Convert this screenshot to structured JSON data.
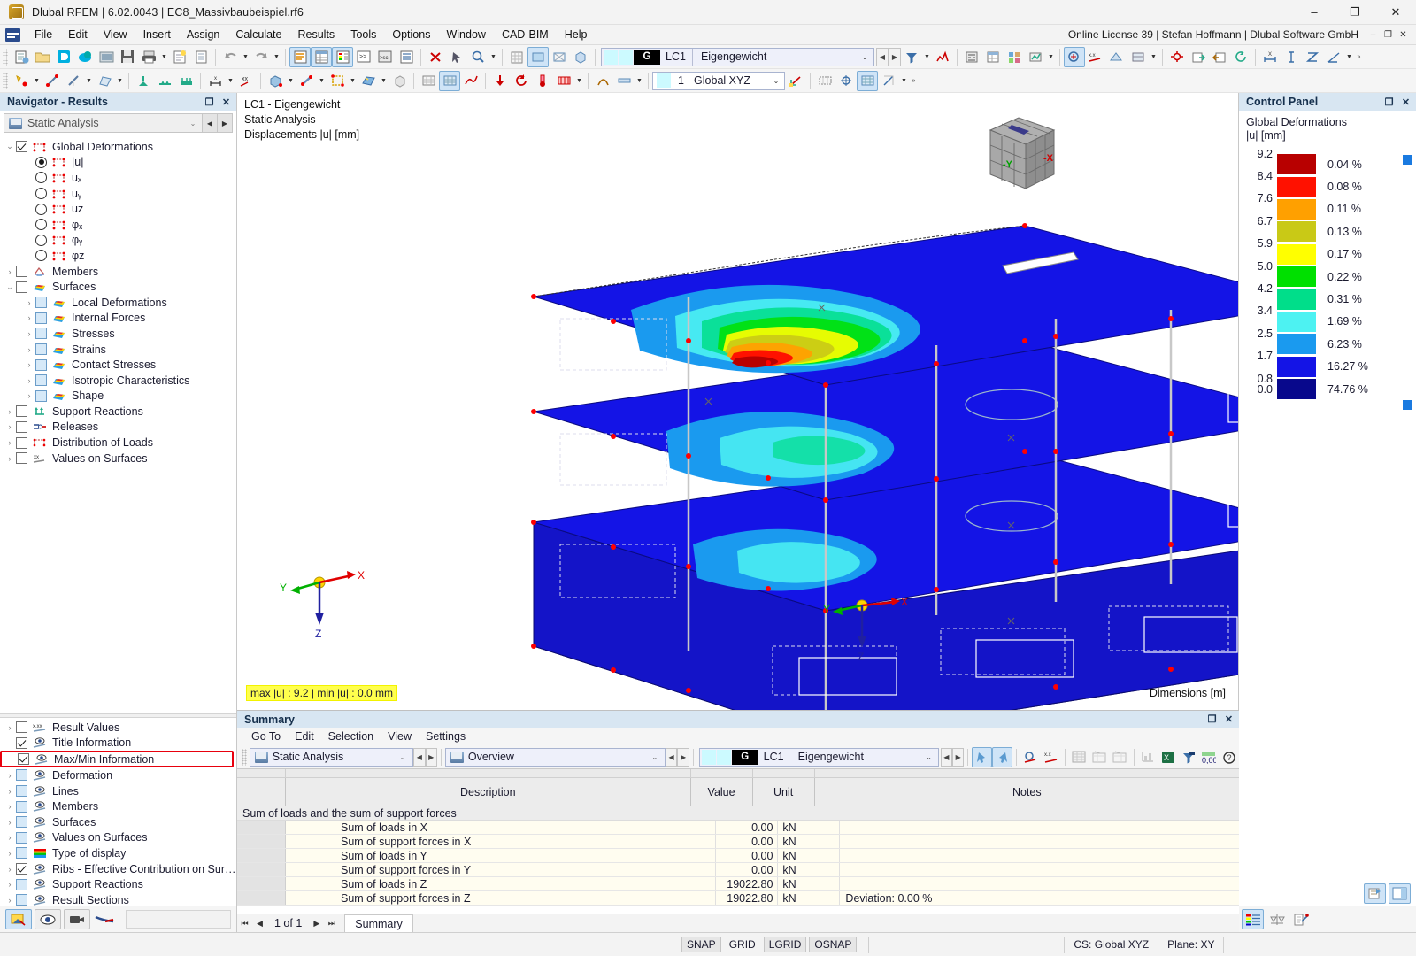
{
  "window": {
    "title": "Dlubal RFEM | 6.02.0043 | EC8_Massivbaubeispiel.rf6",
    "app_icon": "rfem-app-icon",
    "minimize": "–",
    "maximize": "❐",
    "close": "✕"
  },
  "menu": {
    "items": [
      "File",
      "Edit",
      "View",
      "Insert",
      "Assign",
      "Calculate",
      "Results",
      "Tools",
      "Options",
      "Window",
      "CAD-BIM",
      "Help"
    ],
    "license": "Online License 39 | Stefan Hoffmann | Dlubal Software GmbH",
    "min": "–",
    "max": "❐",
    "close": "✕"
  },
  "toolbar": {
    "load_case": {
      "id": "LC1",
      "g_badge": "G",
      "name": "Eigengewicht",
      "chevron": "⌄",
      "prev": "◀",
      "next": "▶"
    },
    "coordinate_system": {
      "value": "1 - Global XYZ",
      "chevron": "⌄"
    },
    "overflow": "»"
  },
  "navigator": {
    "title": "Navigator - Results",
    "undock": "❐",
    "close": "✕",
    "analysis_combo": {
      "value": "Static Analysis",
      "chevron": "⌄",
      "prev": "◀",
      "next": "▶"
    },
    "tree": [
      {
        "label": "Global Deformations",
        "level": 0,
        "expander": "⌄",
        "control": "checkbox-checked",
        "icon": "deformation-icon"
      },
      {
        "label": "|u|",
        "level": 1,
        "expander": "",
        "control": "radio-on",
        "icon": "deformation-icon"
      },
      {
        "label": "uₓ",
        "level": 1,
        "expander": "",
        "control": "radio-off",
        "icon": "deformation-icon"
      },
      {
        "label": "uᵧ",
        "level": 1,
        "expander": "",
        "control": "radio-off",
        "icon": "deformation-icon"
      },
      {
        "label": "uᴢ",
        "level": 1,
        "expander": "",
        "control": "radio-off",
        "icon": "deformation-icon"
      },
      {
        "label": "φₓ",
        "level": 1,
        "expander": "",
        "control": "radio-off",
        "icon": "deformation-icon"
      },
      {
        "label": "φᵧ",
        "level": 1,
        "expander": "",
        "control": "radio-off",
        "icon": "deformation-icon"
      },
      {
        "label": "φᴢ",
        "level": 1,
        "expander": "",
        "control": "radio-off",
        "icon": "deformation-icon"
      },
      {
        "label": "Members",
        "level": 0,
        "expander": "›",
        "control": "checkbox",
        "icon": "members-icon"
      },
      {
        "label": "Surfaces",
        "level": 0,
        "expander": "⌄",
        "control": "checkbox",
        "icon": "surface-icon"
      },
      {
        "label": "Local Deformations",
        "level": 1,
        "expander": "›",
        "control": "checkbox-lightblue",
        "icon": "surface-icon"
      },
      {
        "label": "Internal Forces",
        "level": 1,
        "expander": "›",
        "control": "checkbox-lightblue",
        "icon": "surface-icon"
      },
      {
        "label": "Stresses",
        "level": 1,
        "expander": "›",
        "control": "checkbox-lightblue",
        "icon": "surface-icon"
      },
      {
        "label": "Strains",
        "level": 1,
        "expander": "›",
        "control": "checkbox-lightblue",
        "icon": "surface-icon"
      },
      {
        "label": "Contact Stresses",
        "level": 1,
        "expander": "›",
        "control": "checkbox-lightblue",
        "icon": "surface-icon"
      },
      {
        "label": "Isotropic Characteristics",
        "level": 1,
        "expander": "›",
        "control": "checkbox-lightblue",
        "icon": "surface-icon"
      },
      {
        "label": "Shape",
        "level": 1,
        "expander": "›",
        "control": "checkbox-lightblue",
        "icon": "surface-icon"
      },
      {
        "label": "Support Reactions",
        "level": 0,
        "expander": "›",
        "control": "checkbox",
        "icon": "support-icon"
      },
      {
        "label": "Releases",
        "level": 0,
        "expander": "›",
        "control": "checkbox",
        "icon": "release-icon"
      },
      {
        "label": "Distribution of Loads",
        "level": 0,
        "expander": "›",
        "control": "checkbox",
        "icon": "loads-icon"
      },
      {
        "label": "Values on Surfaces",
        "level": 0,
        "expander": "›",
        "control": "checkbox",
        "icon": "values-icon"
      }
    ],
    "tree2": [
      {
        "label": "Result Values",
        "expander": "›",
        "control": "checkbox",
        "icon": "result-values-icon",
        "highlight": false
      },
      {
        "label": "Title Information",
        "expander": "",
        "control": "checkbox-checked",
        "icon": "display-icon",
        "highlight": false
      },
      {
        "label": "Max/Min Information",
        "expander": "",
        "control": "checkbox-checked",
        "icon": "display-icon",
        "highlight": true
      },
      {
        "label": "Deformation",
        "expander": "›",
        "control": "checkbox-lightblue",
        "icon": "display-icon",
        "highlight": false
      },
      {
        "label": "Lines",
        "expander": "›",
        "control": "checkbox-lightblue",
        "icon": "display-icon",
        "highlight": false
      },
      {
        "label": "Members",
        "expander": "›",
        "control": "checkbox-lightblue",
        "icon": "display-icon",
        "highlight": false
      },
      {
        "label": "Surfaces",
        "expander": "›",
        "control": "checkbox-lightblue",
        "icon": "display-icon",
        "highlight": false
      },
      {
        "label": "Values on Surfaces",
        "expander": "›",
        "control": "checkbox-lightblue",
        "icon": "display-icon",
        "highlight": false
      },
      {
        "label": "Type of display",
        "expander": "›",
        "control": "checkbox-lightblue",
        "icon": "rainbow-icon",
        "highlight": false
      },
      {
        "label": "Ribs - Effective Contribution on Surfac...",
        "expander": "›",
        "control": "checkbox-checked",
        "icon": "display-icon",
        "highlight": false
      },
      {
        "label": "Support Reactions",
        "expander": "›",
        "control": "checkbox-lightblue",
        "icon": "display-icon",
        "highlight": false
      },
      {
        "label": "Result Sections",
        "expander": "›",
        "control": "checkbox-lightblue",
        "icon": "display-icon",
        "highlight": false
      }
    ],
    "footer_buttons": [
      "render-mode-icon",
      "visibility-icon",
      "camera-icon",
      "clipping-icon"
    ]
  },
  "viewport": {
    "title_line1": "LC1 - Eigengewicht",
    "title_line2": "Static Analysis",
    "title_line3": "Displacements |u| [mm]",
    "maxmin": "max |u| : 9.2 | min |u| : 0.0 mm",
    "dimensions": "Dimensions [m]",
    "axes": {
      "x": "X",
      "y": "Y",
      "z": "Z"
    },
    "viewcube": {
      "left_face": "-Y",
      "right_face": "-X"
    }
  },
  "control_panel": {
    "title": "Control Panel",
    "undock": "❐",
    "close": "✕",
    "subtitle_line1": "Global Deformations",
    "subtitle_line2": "|u| [mm]",
    "footer_buttons": [
      "legend-icon",
      "scale-icon",
      "edit-legend-icon"
    ],
    "top_buttons": [
      "print-icon",
      "panel-icon"
    ]
  },
  "chart_data": {
    "type": "table",
    "title": "Global Deformations |u| [mm]",
    "ylabel": "|u| [mm]",
    "boundaries": [
      "9.2",
      "8.4",
      "7.6",
      "6.7",
      "5.9",
      "5.0",
      "4.2",
      "3.4",
      "2.5",
      "1.7",
      "0.8",
      "0.0"
    ],
    "bands": [
      {
        "color": "#b80000",
        "percent": "0.04 %",
        "upper": 9.2,
        "lower": 8.4
      },
      {
        "color": "#ff1100",
        "percent": "0.08 %",
        "upper": 8.4,
        "lower": 7.6
      },
      {
        "color": "#ffa000",
        "percent": "0.11 %",
        "upper": 7.6,
        "lower": 6.7
      },
      {
        "color": "#c9c916",
        "percent": "0.13 %",
        "upper": 6.7,
        "lower": 5.9
      },
      {
        "color": "#ffff00",
        "percent": "0.17 %",
        "upper": 5.9,
        "lower": 5.0
      },
      {
        "color": "#00e000",
        "percent": "0.22 %",
        "upper": 5.0,
        "lower": 4.2
      },
      {
        "color": "#00de8a",
        "percent": "0.31 %",
        "upper": 4.2,
        "lower": 3.4
      },
      {
        "color": "#4df2f2",
        "percent": "1.69 %",
        "upper": 3.4,
        "lower": 2.5
      },
      {
        "color": "#1a9aef",
        "percent": "6.23 %",
        "upper": 2.5,
        "lower": 1.7
      },
      {
        "color": "#1414e6",
        "percent": "16.27 %",
        "upper": 1.7,
        "lower": 0.8
      },
      {
        "color": "#08088c",
        "percent": "74.76 %",
        "upper": 0.8,
        "lower": 0.0
      }
    ]
  },
  "summary": {
    "title": "Summary",
    "undock": "❐",
    "close": "✕",
    "menu": [
      "Go To",
      "Edit",
      "Selection",
      "View",
      "Settings"
    ],
    "analysis_combo": {
      "value": "Static Analysis",
      "chevron": "⌄",
      "prev": "◀",
      "next": "▶"
    },
    "view_combo": {
      "value": "Overview",
      "chevron": "⌄",
      "prev": "◀",
      "next": "▶"
    },
    "load_case": {
      "id": "LC1",
      "g_badge": "G",
      "name": "Eigengewicht",
      "chevron": "⌄",
      "prev": "◀",
      "next": "▶"
    },
    "columns": [
      "",
      "Description",
      "Value",
      "Unit",
      "Notes"
    ],
    "group_row": "Sum of loads and the sum of support forces",
    "rows": [
      {
        "description": "Sum of loads in X",
        "value": "0.00",
        "unit": "kN",
        "notes": ""
      },
      {
        "description": "Sum of support forces in X",
        "value": "0.00",
        "unit": "kN",
        "notes": ""
      },
      {
        "description": "Sum of loads in Y",
        "value": "0.00",
        "unit": "kN",
        "notes": ""
      },
      {
        "description": "Sum of support forces in Y",
        "value": "0.00",
        "unit": "kN",
        "notes": ""
      },
      {
        "description": "Sum of loads in Z",
        "value": "19022.80",
        "unit": "kN",
        "notes": ""
      },
      {
        "description": "Sum of support forces in Z",
        "value": "19022.80",
        "unit": "kN",
        "notes": "Deviation: 0.00 %"
      }
    ],
    "pager": {
      "first": "⏮",
      "prev": "◀",
      "label": "1 of 1",
      "next": "▶",
      "last": "⏭"
    },
    "tab": "Summary"
  },
  "statusbar": {
    "toggles": [
      {
        "label": "SNAP",
        "active": true
      },
      {
        "label": "GRID",
        "active": false
      },
      {
        "label": "LGRID",
        "active": true
      },
      {
        "label": "OSNAP",
        "active": true
      }
    ],
    "cs": "CS: Global XYZ",
    "plane": "Plane: XY"
  }
}
